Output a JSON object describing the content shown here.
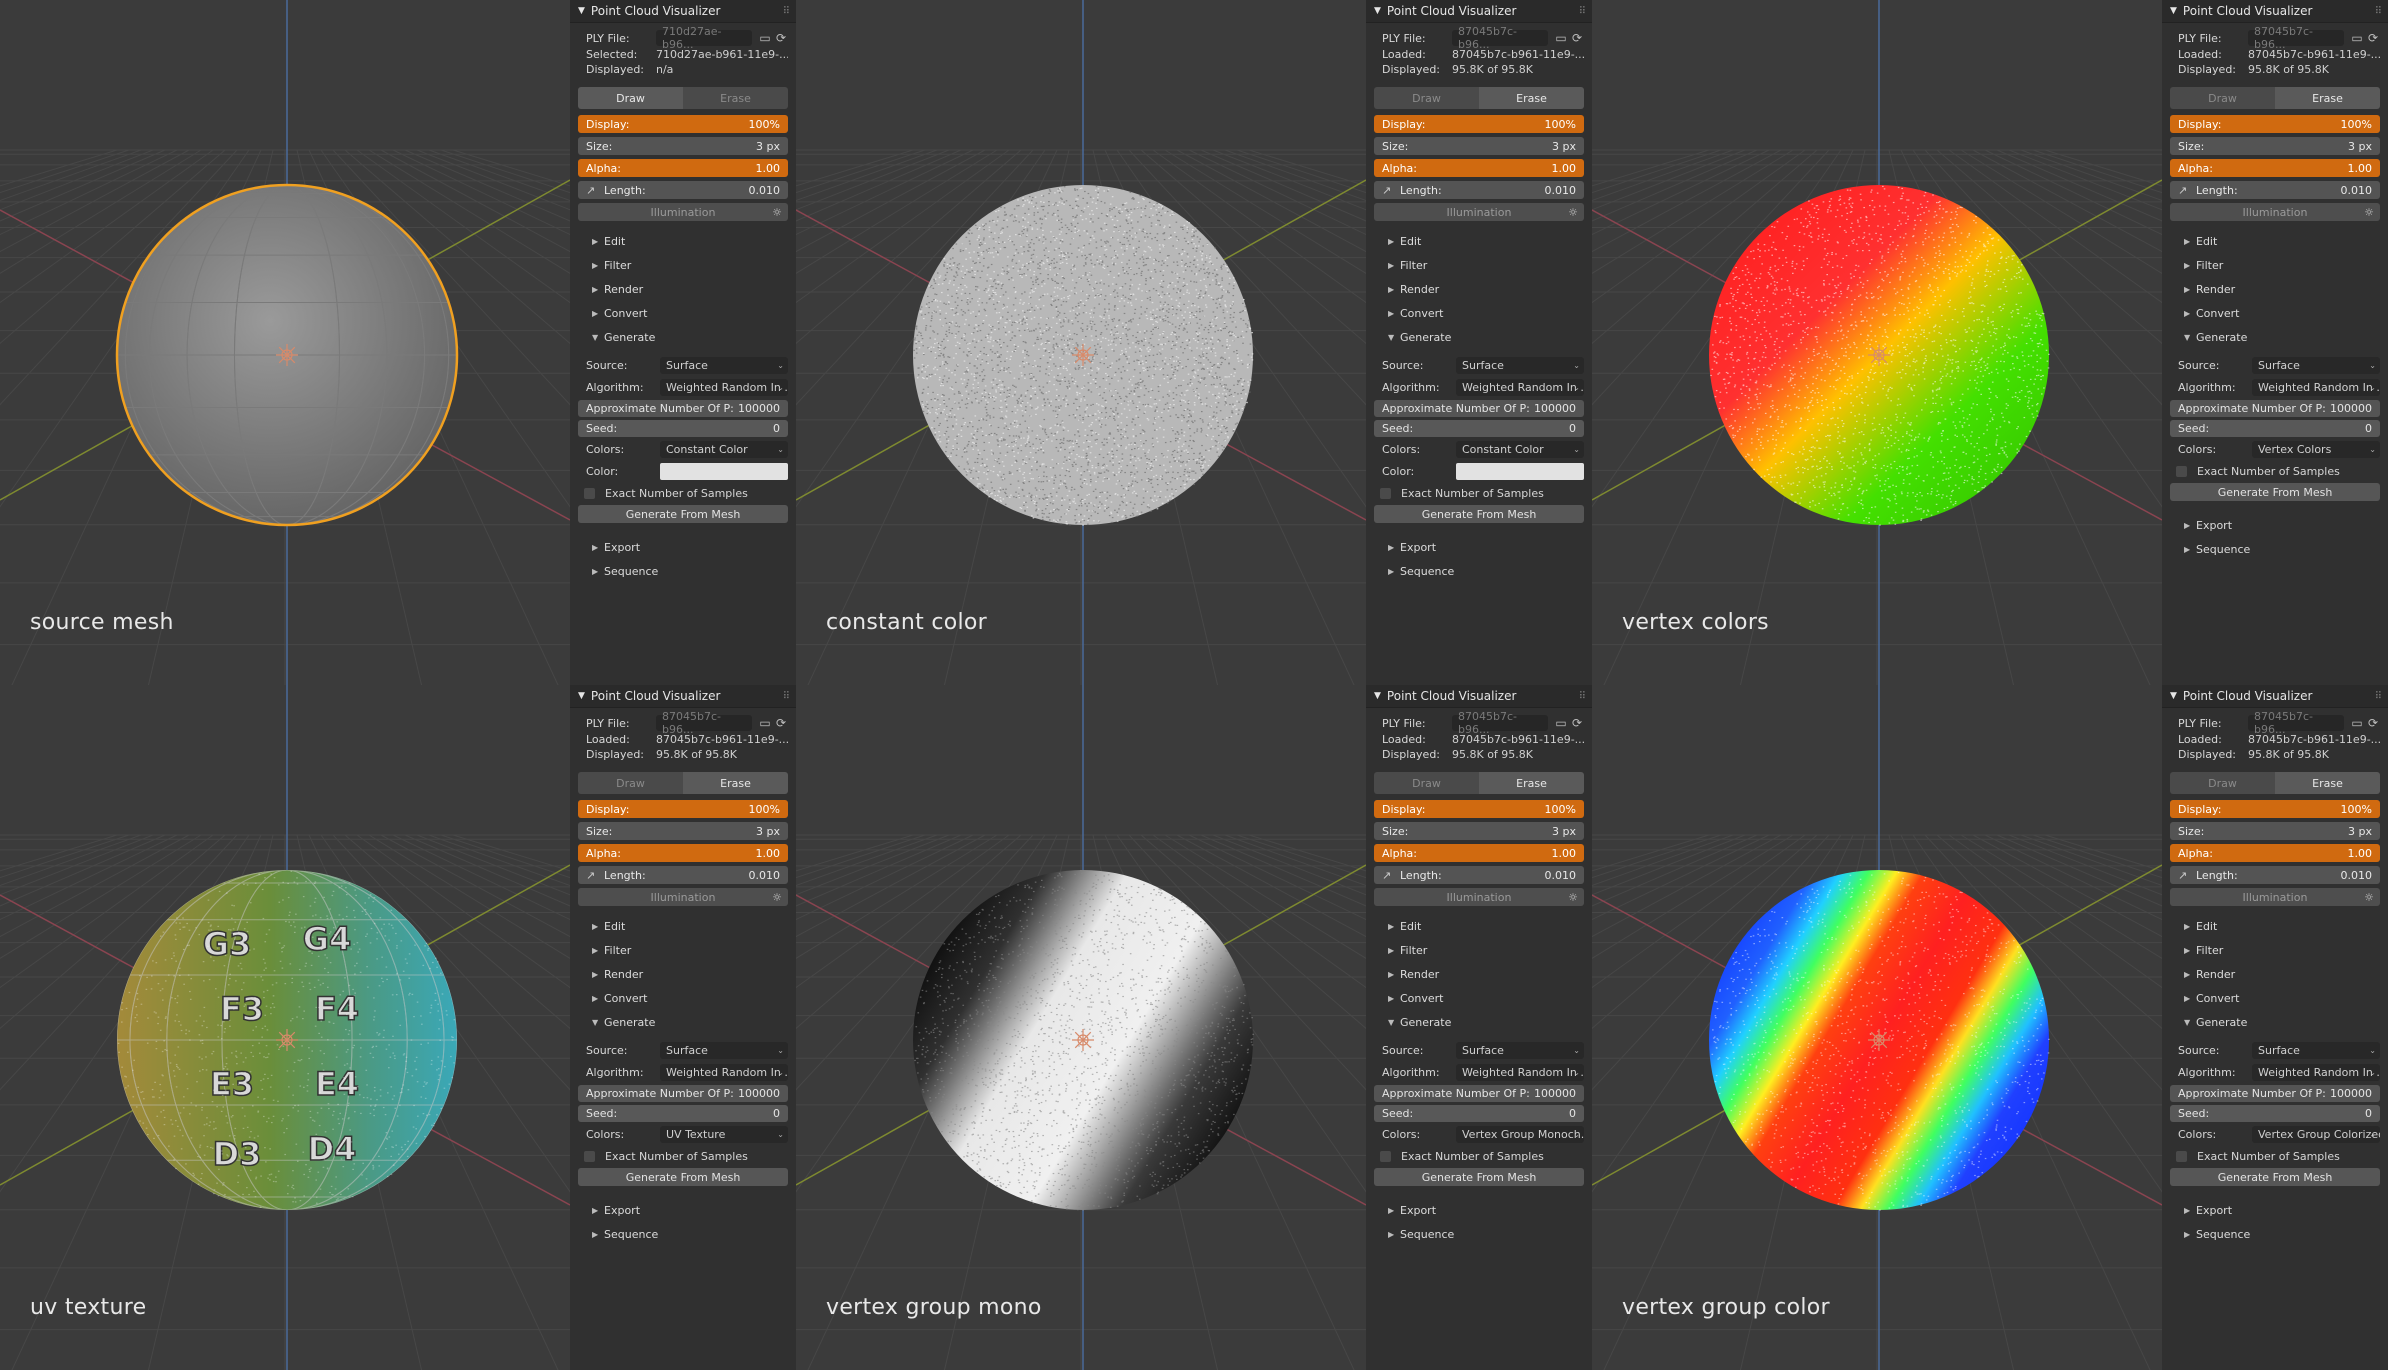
{
  "colors": {
    "accent_orange": "#d06a10",
    "panel_bg": "#303030",
    "viewport_bg": "#3a3a3a",
    "selection_outline": "#f0a020"
  },
  "cells": [
    {
      "caption": "source mesh",
      "panel": {
        "title": "Point Cloud Visualizer",
        "ply_label": "PLY File:",
        "ply_value": "710d27ae-b96...",
        "info1_label": "Selected:",
        "info1_value": "710d27ae-b961-11e9-...",
        "info2_label": "Displayed:",
        "info2_value": "n/a",
        "tab_draw": "Draw",
        "tab_erase": "Erase",
        "active_tab": "draw",
        "display_label": "Display:",
        "display_value": "100%",
        "size_label": "Size:",
        "size_value": "3 px",
        "alpha_label": "Alpha:",
        "alpha_value": "1.00",
        "length_label": "Length:",
        "length_value": "0.010",
        "illumination": "Illumination",
        "edit": "Edit",
        "filter": "Filter",
        "render": "Render",
        "convert": "Convert",
        "generate": "Generate",
        "source_label": "Source:",
        "source_value": "Surface",
        "algorithm_label": "Algorithm:",
        "algorithm_value": "Weighted Random In ...",
        "approx_label": "Approximate Number Of P:",
        "approx_value": "100000",
        "seed_label": "Seed:",
        "seed_value": "0",
        "colors_label": "Colors:",
        "colors_value": "Constant Color",
        "color_label": "Color:",
        "has_color": true,
        "exact": "Exact Number of Samples",
        "gen_button": "Generate From Mesh",
        "export": "Export",
        "sequence": "Sequence"
      }
    },
    {
      "caption": "constant color",
      "panel": {
        "title": "Point Cloud Visualizer",
        "ply_label": "PLY File:",
        "ply_value": "87045b7c-b96...",
        "info1_label": "Loaded:",
        "info1_value": "87045b7c-b961-11e9-...",
        "info2_label": "Displayed:",
        "info2_value": "95.8K of 95.8K",
        "tab_draw": "Draw",
        "tab_erase": "Erase",
        "active_tab": "erase",
        "display_label": "Display:",
        "display_value": "100%",
        "size_label": "Size:",
        "size_value": "3 px",
        "alpha_label": "Alpha:",
        "alpha_value": "1.00",
        "length_label": "Length:",
        "length_value": "0.010",
        "illumination": "Illumination",
        "edit": "Edit",
        "filter": "Filter",
        "render": "Render",
        "convert": "Convert",
        "generate": "Generate",
        "source_label": "Source:",
        "source_value": "Surface",
        "algorithm_label": "Algorithm:",
        "algorithm_value": "Weighted Random In ...",
        "approx_label": "Approximate Number Of P:",
        "approx_value": "100000",
        "seed_label": "Seed:",
        "seed_value": "0",
        "colors_label": "Colors:",
        "colors_value": "Constant Color",
        "color_label": "Color:",
        "has_color": true,
        "exact": "Exact Number of Samples",
        "gen_button": "Generate From Mesh",
        "export": "Export",
        "sequence": "Sequence"
      }
    },
    {
      "caption": "vertex colors",
      "panel": {
        "title": "Point Cloud Visualizer",
        "ply_label": "PLY File:",
        "ply_value": "87045b7c-b96...",
        "info1_label": "Loaded:",
        "info1_value": "87045b7c-b961-11e9-...",
        "info2_label": "Displayed:",
        "info2_value": "95.8K of 95.8K",
        "tab_draw": "Draw",
        "tab_erase": "Erase",
        "active_tab": "erase",
        "display_label": "Display:",
        "display_value": "100%",
        "size_label": "Size:",
        "size_value": "3 px",
        "alpha_label": "Alpha:",
        "alpha_value": "1.00",
        "length_label": "Length:",
        "length_value": "0.010",
        "illumination": "Illumination",
        "edit": "Edit",
        "filter": "Filter",
        "render": "Render",
        "convert": "Convert",
        "generate": "Generate",
        "source_label": "Source:",
        "source_value": "Surface",
        "algorithm_label": "Algorithm:",
        "algorithm_value": "Weighted Random In ...",
        "approx_label": "Approximate Number Of P:",
        "approx_value": "100000",
        "seed_label": "Seed:",
        "seed_value": "0",
        "colors_label": "Colors:",
        "colors_value": "Vertex Colors",
        "color_label": "",
        "has_color": false,
        "exact": "Exact Number of Samples",
        "gen_button": "Generate From Mesh",
        "export": "Export",
        "sequence": "Sequence"
      }
    },
    {
      "caption": "uv texture",
      "panel": {
        "title": "Point Cloud Visualizer",
        "ply_label": "PLY File:",
        "ply_value": "87045b7c-b96...",
        "info1_label": "Loaded:",
        "info1_value": "87045b7c-b961-11e9-...",
        "info2_label": "Displayed:",
        "info2_value": "95.8K of 95.8K",
        "tab_draw": "Draw",
        "tab_erase": "Erase",
        "active_tab": "erase",
        "display_label": "Display:",
        "display_value": "100%",
        "size_label": "Size:",
        "size_value": "3 px",
        "alpha_label": "Alpha:",
        "alpha_value": "1.00",
        "length_label": "Length:",
        "length_value": "0.010",
        "illumination": "Illumination",
        "edit": "Edit",
        "filter": "Filter",
        "render": "Render",
        "convert": "Convert",
        "generate": "Generate",
        "source_label": "Source:",
        "source_value": "Surface",
        "algorithm_label": "Algorithm:",
        "algorithm_value": "Weighted Random In ...",
        "approx_label": "Approximate Number Of P:",
        "approx_value": "100000",
        "seed_label": "Seed:",
        "seed_value": "0",
        "colors_label": "Colors:",
        "colors_value": "UV Texture",
        "color_label": "",
        "has_color": false,
        "exact": "Exact Number of Samples",
        "gen_button": "Generate From Mesh",
        "export": "Export",
        "sequence": "Sequence"
      }
    },
    {
      "caption": "vertex group mono",
      "panel": {
        "title": "Point Cloud Visualizer",
        "ply_label": "PLY File:",
        "ply_value": "87045b7c-b96...",
        "info1_label": "Loaded:",
        "info1_value": "87045b7c-b961-11e9-...",
        "info2_label": "Displayed:",
        "info2_value": "95.8K of 95.8K",
        "tab_draw": "Draw",
        "tab_erase": "Erase",
        "active_tab": "erase",
        "display_label": "Display:",
        "display_value": "100%",
        "size_label": "Size:",
        "size_value": "3 px",
        "alpha_label": "Alpha:",
        "alpha_value": "1.00",
        "length_label": "Length:",
        "length_value": "0.010",
        "illumination": "Illumination",
        "edit": "Edit",
        "filter": "Filter",
        "render": "Render",
        "convert": "Convert",
        "generate": "Generate",
        "source_label": "Source:",
        "source_value": "Surface",
        "algorithm_label": "Algorithm:",
        "algorithm_value": "Weighted Random In ...",
        "approx_label": "Approximate Number Of P:",
        "approx_value": "100000",
        "seed_label": "Seed:",
        "seed_value": "0",
        "colors_label": "Colors:",
        "colors_value": "Vertex Group Monoch...",
        "color_label": "",
        "has_color": false,
        "exact": "Exact Number of Samples",
        "gen_button": "Generate From Mesh",
        "export": "Export",
        "sequence": "Sequence"
      }
    },
    {
      "caption": "vertex group color",
      "panel": {
        "title": "Point Cloud Visualizer",
        "ply_label": "PLY File:",
        "ply_value": "87045b7c-b96...",
        "info1_label": "Loaded:",
        "info1_value": "87045b7c-b961-11e9-...",
        "info2_label": "Displayed:",
        "info2_value": "95.8K of 95.8K",
        "tab_draw": "Draw",
        "tab_erase": "Erase",
        "active_tab": "erase",
        "display_label": "Display:",
        "display_value": "100%",
        "size_label": "Size:",
        "size_value": "3 px",
        "alpha_label": "Alpha:",
        "alpha_value": "1.00",
        "length_label": "Length:",
        "length_value": "0.010",
        "illumination": "Illumination",
        "edit": "Edit",
        "filter": "Filter",
        "render": "Render",
        "convert": "Convert",
        "generate": "Generate",
        "source_label": "Source:",
        "source_value": "Surface",
        "algorithm_label": "Algorithm:",
        "algorithm_value": "Weighted Random In ...",
        "approx_label": "Approximate Number Of P:",
        "approx_value": "100000",
        "seed_label": "Seed:",
        "seed_value": "0",
        "colors_label": "Colors:",
        "colors_value": "Vertex Group Colorized",
        "color_label": "",
        "has_color": false,
        "exact": "Exact Number of Samples",
        "gen_button": "Generate From Mesh",
        "export": "Export",
        "sequence": "Sequence"
      }
    }
  ],
  "uv_labels": [
    "F3",
    "F4",
    "E3",
    "E4",
    "G3",
    "G4",
    "D3",
    "D4"
  ]
}
